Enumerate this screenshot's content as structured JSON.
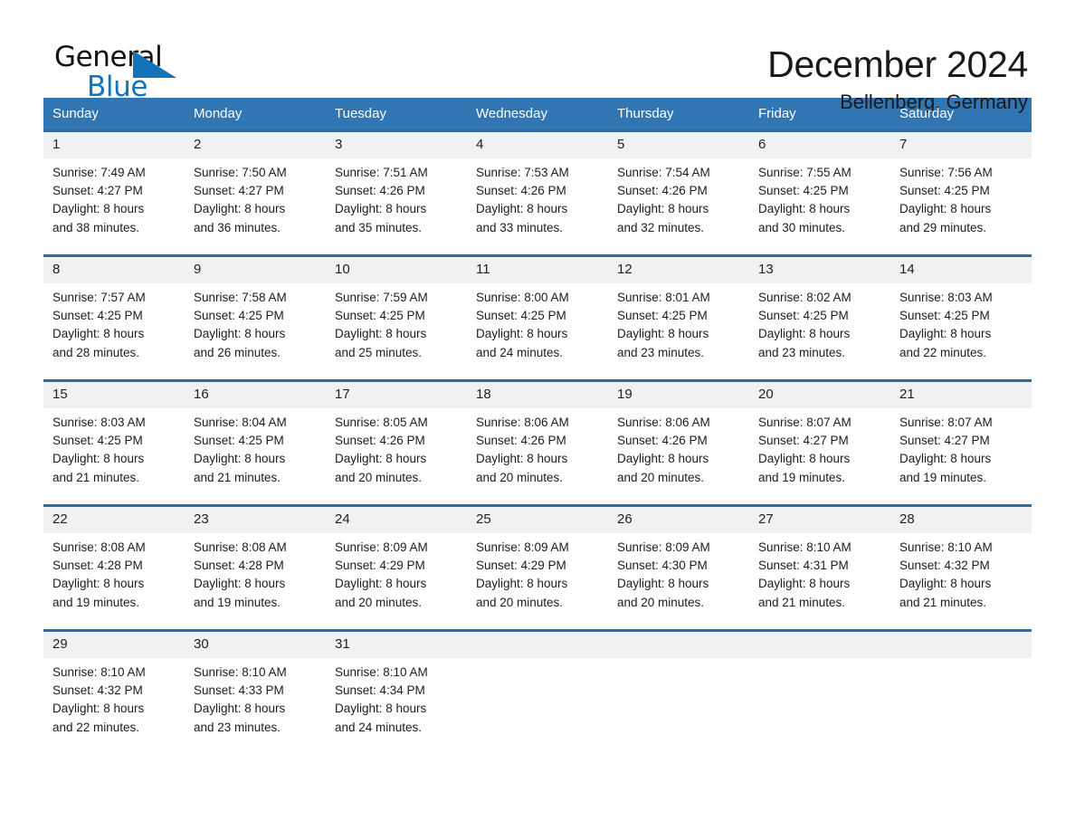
{
  "brand": {
    "name_part1": "General",
    "name_part2": "Blue",
    "accent_color": "#1273bb"
  },
  "header": {
    "month_title": "December 2024",
    "location": "Bellenberg, Germany",
    "header_bg_color": "#3175b2",
    "row_divider_color": "#2e6da4"
  },
  "weekday_headers": [
    "Sunday",
    "Monday",
    "Tuesday",
    "Wednesday",
    "Thursday",
    "Friday",
    "Saturday"
  ],
  "weeks": [
    {
      "days": [
        {
          "date": "1",
          "sunrise": "Sunrise: 7:49 AM",
          "sunset": "Sunset: 4:27 PM",
          "daylight_line1": "Daylight: 8 hours",
          "daylight_line2": "and 38 minutes."
        },
        {
          "date": "2",
          "sunrise": "Sunrise: 7:50 AM",
          "sunset": "Sunset: 4:27 PM",
          "daylight_line1": "Daylight: 8 hours",
          "daylight_line2": "and 36 minutes."
        },
        {
          "date": "3",
          "sunrise": "Sunrise: 7:51 AM",
          "sunset": "Sunset: 4:26 PM",
          "daylight_line1": "Daylight: 8 hours",
          "daylight_line2": "and 35 minutes."
        },
        {
          "date": "4",
          "sunrise": "Sunrise: 7:53 AM",
          "sunset": "Sunset: 4:26 PM",
          "daylight_line1": "Daylight: 8 hours",
          "daylight_line2": "and 33 minutes."
        },
        {
          "date": "5",
          "sunrise": "Sunrise: 7:54 AM",
          "sunset": "Sunset: 4:26 PM",
          "daylight_line1": "Daylight: 8 hours",
          "daylight_line2": "and 32 minutes."
        },
        {
          "date": "6",
          "sunrise": "Sunrise: 7:55 AM",
          "sunset": "Sunset: 4:25 PM",
          "daylight_line1": "Daylight: 8 hours",
          "daylight_line2": "and 30 minutes."
        },
        {
          "date": "7",
          "sunrise": "Sunrise: 7:56 AM",
          "sunset": "Sunset: 4:25 PM",
          "daylight_line1": "Daylight: 8 hours",
          "daylight_line2": "and 29 minutes."
        }
      ]
    },
    {
      "days": [
        {
          "date": "8",
          "sunrise": "Sunrise: 7:57 AM",
          "sunset": "Sunset: 4:25 PM",
          "daylight_line1": "Daylight: 8 hours",
          "daylight_line2": "and 28 minutes."
        },
        {
          "date": "9",
          "sunrise": "Sunrise: 7:58 AM",
          "sunset": "Sunset: 4:25 PM",
          "daylight_line1": "Daylight: 8 hours",
          "daylight_line2": "and 26 minutes."
        },
        {
          "date": "10",
          "sunrise": "Sunrise: 7:59 AM",
          "sunset": "Sunset: 4:25 PM",
          "daylight_line1": "Daylight: 8 hours",
          "daylight_line2": "and 25 minutes."
        },
        {
          "date": "11",
          "sunrise": "Sunrise: 8:00 AM",
          "sunset": "Sunset: 4:25 PM",
          "daylight_line1": "Daylight: 8 hours",
          "daylight_line2": "and 24 minutes."
        },
        {
          "date": "12",
          "sunrise": "Sunrise: 8:01 AM",
          "sunset": "Sunset: 4:25 PM",
          "daylight_line1": "Daylight: 8 hours",
          "daylight_line2": "and 23 minutes."
        },
        {
          "date": "13",
          "sunrise": "Sunrise: 8:02 AM",
          "sunset": "Sunset: 4:25 PM",
          "daylight_line1": "Daylight: 8 hours",
          "daylight_line2": "and 23 minutes."
        },
        {
          "date": "14",
          "sunrise": "Sunrise: 8:03 AM",
          "sunset": "Sunset: 4:25 PM",
          "daylight_line1": "Daylight: 8 hours",
          "daylight_line2": "and 22 minutes."
        }
      ]
    },
    {
      "days": [
        {
          "date": "15",
          "sunrise": "Sunrise: 8:03 AM",
          "sunset": "Sunset: 4:25 PM",
          "daylight_line1": "Daylight: 8 hours",
          "daylight_line2": "and 21 minutes."
        },
        {
          "date": "16",
          "sunrise": "Sunrise: 8:04 AM",
          "sunset": "Sunset: 4:25 PM",
          "daylight_line1": "Daylight: 8 hours",
          "daylight_line2": "and 21 minutes."
        },
        {
          "date": "17",
          "sunrise": "Sunrise: 8:05 AM",
          "sunset": "Sunset: 4:26 PM",
          "daylight_line1": "Daylight: 8 hours",
          "daylight_line2": "and 20 minutes."
        },
        {
          "date": "18",
          "sunrise": "Sunrise: 8:06 AM",
          "sunset": "Sunset: 4:26 PM",
          "daylight_line1": "Daylight: 8 hours",
          "daylight_line2": "and 20 minutes."
        },
        {
          "date": "19",
          "sunrise": "Sunrise: 8:06 AM",
          "sunset": "Sunset: 4:26 PM",
          "daylight_line1": "Daylight: 8 hours",
          "daylight_line2": "and 20 minutes."
        },
        {
          "date": "20",
          "sunrise": "Sunrise: 8:07 AM",
          "sunset": "Sunset: 4:27 PM",
          "daylight_line1": "Daylight: 8 hours",
          "daylight_line2": "and 19 minutes."
        },
        {
          "date": "21",
          "sunrise": "Sunrise: 8:07 AM",
          "sunset": "Sunset: 4:27 PM",
          "daylight_line1": "Daylight: 8 hours",
          "daylight_line2": "and 19 minutes."
        }
      ]
    },
    {
      "days": [
        {
          "date": "22",
          "sunrise": "Sunrise: 8:08 AM",
          "sunset": "Sunset: 4:28 PM",
          "daylight_line1": "Daylight: 8 hours",
          "daylight_line2": "and 19 minutes."
        },
        {
          "date": "23",
          "sunrise": "Sunrise: 8:08 AM",
          "sunset": "Sunset: 4:28 PM",
          "daylight_line1": "Daylight: 8 hours",
          "daylight_line2": "and 19 minutes."
        },
        {
          "date": "24",
          "sunrise": "Sunrise: 8:09 AM",
          "sunset": "Sunset: 4:29 PM",
          "daylight_line1": "Daylight: 8 hours",
          "daylight_line2": "and 20 minutes."
        },
        {
          "date": "25",
          "sunrise": "Sunrise: 8:09 AM",
          "sunset": "Sunset: 4:29 PM",
          "daylight_line1": "Daylight: 8 hours",
          "daylight_line2": "and 20 minutes."
        },
        {
          "date": "26",
          "sunrise": "Sunrise: 8:09 AM",
          "sunset": "Sunset: 4:30 PM",
          "daylight_line1": "Daylight: 8 hours",
          "daylight_line2": "and 20 minutes."
        },
        {
          "date": "27",
          "sunrise": "Sunrise: 8:10 AM",
          "sunset": "Sunset: 4:31 PM",
          "daylight_line1": "Daylight: 8 hours",
          "daylight_line2": "and 21 minutes."
        },
        {
          "date": "28",
          "sunrise": "Sunrise: 8:10 AM",
          "sunset": "Sunset: 4:32 PM",
          "daylight_line1": "Daylight: 8 hours",
          "daylight_line2": "and 21 minutes."
        }
      ]
    },
    {
      "days": [
        {
          "date": "29",
          "sunrise": "Sunrise: 8:10 AM",
          "sunset": "Sunset: 4:32 PM",
          "daylight_line1": "Daylight: 8 hours",
          "daylight_line2": "and 22 minutes."
        },
        {
          "date": "30",
          "sunrise": "Sunrise: 8:10 AM",
          "sunset": "Sunset: 4:33 PM",
          "daylight_line1": "Daylight: 8 hours",
          "daylight_line2": "and 23 minutes."
        },
        {
          "date": "31",
          "sunrise": "Sunrise: 8:10 AM",
          "sunset": "Sunset: 4:34 PM",
          "daylight_line1": "Daylight: 8 hours",
          "daylight_line2": "and 24 minutes."
        },
        {
          "date": "",
          "sunrise": "",
          "sunset": "",
          "daylight_line1": "",
          "daylight_line2": ""
        },
        {
          "date": "",
          "sunrise": "",
          "sunset": "",
          "daylight_line1": "",
          "daylight_line2": ""
        },
        {
          "date": "",
          "sunrise": "",
          "sunset": "",
          "daylight_line1": "",
          "daylight_line2": ""
        },
        {
          "date": "",
          "sunrise": "",
          "sunset": "",
          "daylight_line1": "",
          "daylight_line2": ""
        }
      ]
    }
  ]
}
